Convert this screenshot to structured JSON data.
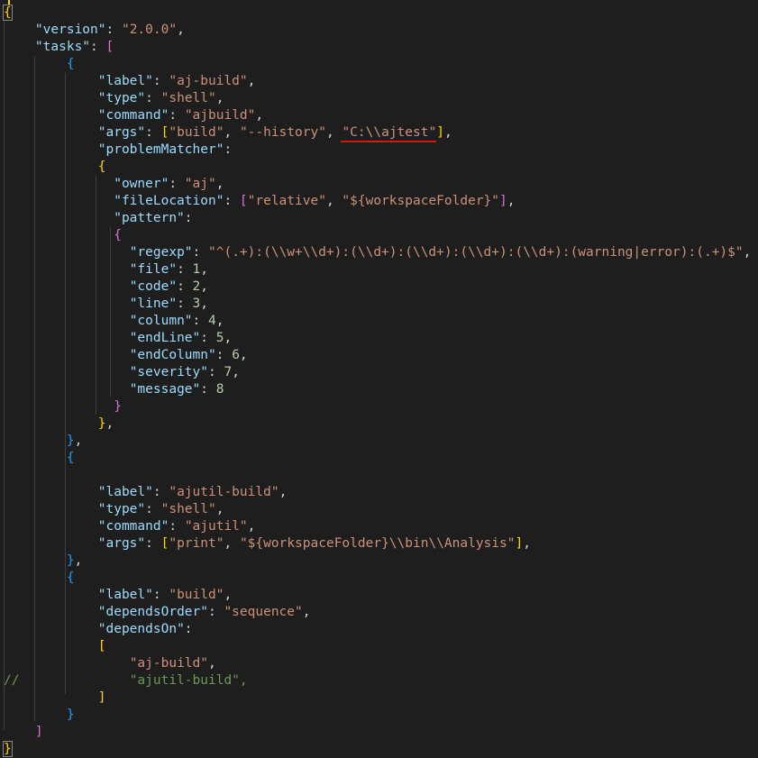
{
  "lines": [
    [
      [
        "b1",
        "{"
      ]
    ],
    [
      [
        "t",
        "    "
      ],
      [
        "k",
        "\"version\""
      ],
      [
        "t",
        ": "
      ],
      [
        "s",
        "\"2.0.0\""
      ],
      [
        "t",
        ","
      ]
    ],
    [
      [
        "t",
        "    "
      ],
      [
        "k",
        "\"tasks\""
      ],
      [
        "t",
        ": "
      ],
      [
        "b2",
        "["
      ]
    ],
    [
      [
        "t",
        "        "
      ],
      [
        "b3",
        "{"
      ]
    ],
    [
      [
        "t",
        "            "
      ],
      [
        "k",
        "\"label\""
      ],
      [
        "t",
        ": "
      ],
      [
        "s",
        "\"aj-build\""
      ],
      [
        "t",
        ","
      ]
    ],
    [
      [
        "t",
        "            "
      ],
      [
        "k",
        "\"type\""
      ],
      [
        "t",
        ": "
      ],
      [
        "s",
        "\"shell\""
      ],
      [
        "t",
        ","
      ]
    ],
    [
      [
        "t",
        "            "
      ],
      [
        "k",
        "\"command\""
      ],
      [
        "t",
        ": "
      ],
      [
        "s",
        "\"ajbuild\""
      ],
      [
        "t",
        ","
      ]
    ],
    [
      [
        "t",
        "            "
      ],
      [
        "k",
        "\"args\""
      ],
      [
        "t",
        ": "
      ],
      [
        "b1",
        "["
      ],
      [
        "s",
        "\"build\""
      ],
      [
        "t",
        ", "
      ],
      [
        "s",
        "\"--history\""
      ],
      [
        "t",
        ", "
      ],
      [
        "s",
        "\"C:\\\\ajtest\""
      ],
      [
        "b1",
        "]"
      ],
      [
        "t",
        ","
      ]
    ],
    [
      [
        "t",
        "            "
      ],
      [
        "k",
        "\"problemMatcher\""
      ],
      [
        "t",
        ":"
      ]
    ],
    [
      [
        "t",
        "            "
      ],
      [
        "b1",
        "{"
      ]
    ],
    [
      [
        "t",
        "              "
      ],
      [
        "k",
        "\"owner\""
      ],
      [
        "t",
        ": "
      ],
      [
        "s",
        "\"aj\""
      ],
      [
        "t",
        ","
      ]
    ],
    [
      [
        "t",
        "              "
      ],
      [
        "k",
        "\"fileLocation\""
      ],
      [
        "t",
        ": "
      ],
      [
        "b2",
        "["
      ],
      [
        "s",
        "\"relative\""
      ],
      [
        "t",
        ", "
      ],
      [
        "s",
        "\"${workspaceFolder}\""
      ],
      [
        "b2",
        "]"
      ],
      [
        "t",
        ","
      ]
    ],
    [
      [
        "t",
        "              "
      ],
      [
        "k",
        "\"pattern\""
      ],
      [
        "t",
        ":"
      ]
    ],
    [
      [
        "t",
        "              "
      ],
      [
        "b2",
        "{"
      ]
    ],
    [
      [
        "t",
        "                "
      ],
      [
        "k",
        "\"regexp\""
      ],
      [
        "t",
        ": "
      ],
      [
        "s",
        "\"^(.+):(\\\\w+\\\\d+):(\\\\d+):(\\\\d+):(\\\\d+):(\\\\d+):(warning|error):(.+)$\""
      ],
      [
        "t",
        ","
      ]
    ],
    [
      [
        "t",
        "                "
      ],
      [
        "k",
        "\"file\""
      ],
      [
        "t",
        ": "
      ],
      [
        "n",
        "1"
      ],
      [
        "t",
        ","
      ]
    ],
    [
      [
        "t",
        "                "
      ],
      [
        "k",
        "\"code\""
      ],
      [
        "t",
        ": "
      ],
      [
        "n",
        "2"
      ],
      [
        "t",
        ","
      ]
    ],
    [
      [
        "t",
        "                "
      ],
      [
        "k",
        "\"line\""
      ],
      [
        "t",
        ": "
      ],
      [
        "n",
        "3"
      ],
      [
        "t",
        ","
      ]
    ],
    [
      [
        "t",
        "                "
      ],
      [
        "k",
        "\"column\""
      ],
      [
        "t",
        ": "
      ],
      [
        "n",
        "4"
      ],
      [
        "t",
        ","
      ]
    ],
    [
      [
        "t",
        "                "
      ],
      [
        "k",
        "\"endLine\""
      ],
      [
        "t",
        ": "
      ],
      [
        "n",
        "5"
      ],
      [
        "t",
        ","
      ]
    ],
    [
      [
        "t",
        "                "
      ],
      [
        "k",
        "\"endColumn\""
      ],
      [
        "t",
        ": "
      ],
      [
        "n",
        "6"
      ],
      [
        "t",
        ","
      ]
    ],
    [
      [
        "t",
        "                "
      ],
      [
        "k",
        "\"severity\""
      ],
      [
        "t",
        ": "
      ],
      [
        "n",
        "7"
      ],
      [
        "t",
        ","
      ]
    ],
    [
      [
        "t",
        "                "
      ],
      [
        "k",
        "\"message\""
      ],
      [
        "t",
        ": "
      ],
      [
        "n",
        "8"
      ]
    ],
    [
      [
        "t",
        "              "
      ],
      [
        "b2",
        "}"
      ]
    ],
    [
      [
        "t",
        "            "
      ],
      [
        "b1",
        "}"
      ],
      [
        "t",
        ","
      ]
    ],
    [
      [
        "t",
        "        "
      ],
      [
        "b3",
        "}"
      ],
      [
        "t",
        ","
      ]
    ],
    [
      [
        "t",
        "        "
      ],
      [
        "b3",
        "{"
      ]
    ],
    [
      [
        "t",
        ""
      ]
    ],
    [
      [
        "t",
        "            "
      ],
      [
        "k",
        "\"label\""
      ],
      [
        "t",
        ": "
      ],
      [
        "s",
        "\"ajutil-build\""
      ],
      [
        "t",
        ","
      ]
    ],
    [
      [
        "t",
        "            "
      ],
      [
        "k",
        "\"type\""
      ],
      [
        "t",
        ": "
      ],
      [
        "s",
        "\"shell\""
      ],
      [
        "t",
        ","
      ]
    ],
    [
      [
        "t",
        "            "
      ],
      [
        "k",
        "\"command\""
      ],
      [
        "t",
        ": "
      ],
      [
        "s",
        "\"ajutil\""
      ],
      [
        "t",
        ","
      ]
    ],
    [
      [
        "t",
        "            "
      ],
      [
        "k",
        "\"args\""
      ],
      [
        "t",
        ": "
      ],
      [
        "b1",
        "["
      ],
      [
        "s",
        "\"print\""
      ],
      [
        "t",
        ", "
      ],
      [
        "s",
        "\"${workspaceFolder}\\\\bin\\\\Analysis\""
      ],
      [
        "b1",
        "]"
      ],
      [
        "t",
        ","
      ]
    ],
    [
      [
        "t",
        "        "
      ],
      [
        "b3",
        "}"
      ],
      [
        "t",
        ","
      ]
    ],
    [
      [
        "t",
        "        "
      ],
      [
        "b3",
        "{"
      ]
    ],
    [
      [
        "t",
        "            "
      ],
      [
        "k",
        "\"label\""
      ],
      [
        "t",
        ": "
      ],
      [
        "s",
        "\"build\""
      ],
      [
        "t",
        ","
      ]
    ],
    [
      [
        "t",
        "            "
      ],
      [
        "k",
        "\"dependsOrder\""
      ],
      [
        "t",
        ": "
      ],
      [
        "s",
        "\"sequence\""
      ],
      [
        "t",
        ","
      ]
    ],
    [
      [
        "t",
        "            "
      ],
      [
        "k",
        "\"dependsOn\""
      ],
      [
        "t",
        ":"
      ]
    ],
    [
      [
        "t",
        "            "
      ],
      [
        "b1",
        "["
      ]
    ],
    [
      [
        "t",
        "                "
      ],
      [
        "s",
        "\"aj-build\""
      ],
      [
        "t",
        ","
      ]
    ],
    [
      [
        "c",
        "//"
      ],
      [
        "t",
        "              "
      ],
      [
        "c",
        "\"ajutil-build\","
      ]
    ],
    [
      [
        "t",
        "            "
      ],
      [
        "b1",
        "]"
      ]
    ],
    [
      [
        "t",
        "        "
      ],
      [
        "b3",
        "}"
      ]
    ],
    [
      [
        "t",
        "    "
      ],
      [
        "b2",
        "]"
      ]
    ],
    [
      [
        "b1",
        "}"
      ]
    ]
  ]
}
